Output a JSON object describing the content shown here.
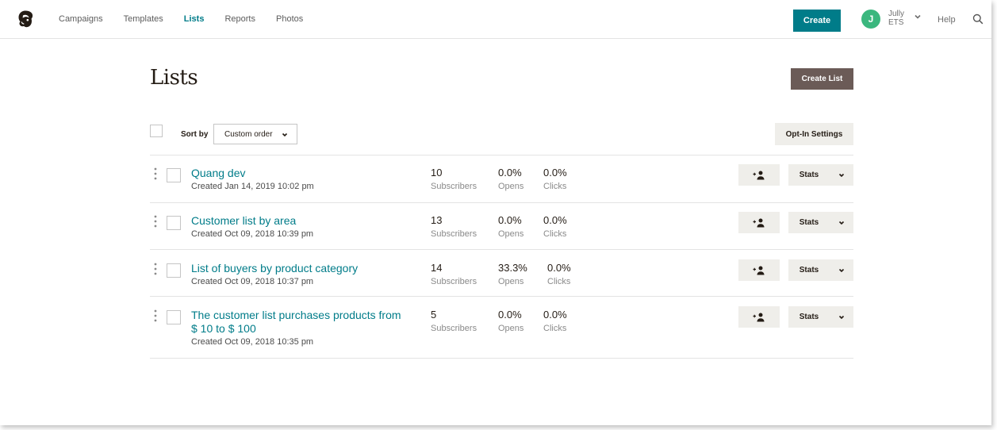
{
  "nav": {
    "links": [
      "Campaigns",
      "Templates",
      "Lists",
      "Reports",
      "Photos"
    ],
    "active": "Lists",
    "create_label": "Create",
    "avatar_letter": "J",
    "user_name": "Jully",
    "user_org": "ETS",
    "help_label": "Help"
  },
  "page": {
    "title": "Lists",
    "create_list_label": "Create List",
    "sort_by_label": "Sort by",
    "sort_value": "Custom order",
    "optin_label": "Opt-In Settings"
  },
  "lists": [
    {
      "name": "Quang dev",
      "created": "Created Jan 14, 2019 10:02 pm",
      "subscribers": "10",
      "opens": "0.0%",
      "clicks": "0.0%"
    },
    {
      "name": "Customer list by area",
      "created": "Created Oct 09, 2018 10:39 pm",
      "subscribers": "13",
      "opens": "0.0%",
      "clicks": "0.0%"
    },
    {
      "name": "List of buyers by product category",
      "created": "Created Oct 09, 2018 10:37 pm",
      "subscribers": "14",
      "opens": "33.3%",
      "clicks": "0.0%"
    },
    {
      "name": "The customer list purchases products from $ 10 to $ 100",
      "created": "Created Oct 09, 2018 10:35 pm",
      "subscribers": "5",
      "opens": "0.0%",
      "clicks": "0.0%"
    }
  ],
  "labels": {
    "subscribers": "Subscribers",
    "opens": "Opens",
    "clicks": "Clicks",
    "stats": "Stats"
  },
  "colors": {
    "accent": "#007c89",
    "create_list_bg": "#6b5b57",
    "avatar": "#3bb77e",
    "button_gray": "#efeeea"
  },
  "icons": [
    "mailchimp-logo-icon",
    "chevron-down-icon",
    "search-icon",
    "kebab-icon",
    "add-subscriber-icon"
  ]
}
